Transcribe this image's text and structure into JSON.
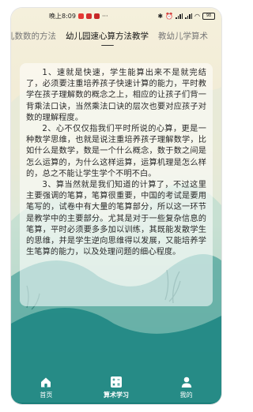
{
  "status_bar": {
    "time": "晚上8:09",
    "battery": "98"
  },
  "tabs": [
    {
      "label": "儿数数的方法",
      "active": false
    },
    {
      "label": "幼儿园速心算方法教学",
      "active": true
    },
    {
      "label": "教幼儿学算术",
      "active": false
    }
  ],
  "article": {
    "paragraphs": [
      "1、速就是快速，学生能算出来不是就完结了，必须要注重培养孩子快速计算的能力，平时教学在孩子理解数的概念之上，相应的让孩子们背一背乘法口诀，当然乘法口诀的层次也要对应孩子对数的理解程度。",
      "2、心不仅仅指我们平时所说的心算，更是一种数学思维，也就是说注重培养孩子理解数学，比如什么是数学，数是一个什么概念，数于数之间是怎么运算的，为什么这样运算，运算机理是怎么样的，总之不能让学生学个不明不白。",
      "3、算当然就是我们知道的计算了，不过这里主要强调的笔算，笔算很重要，中国的考试是要用笔写的，试卷中有大量的笔算部分，所以这一环节是教学中的主要部分。尤其是对于一些复杂信息的笔算，平时必须要多多加以训练，其既能发散学生的思维，并是学生逆向思维得以发展，又能培养学生笔算的能力，以及处理问题的细心程度。"
    ]
  },
  "bottom_nav": [
    {
      "label": "首页",
      "icon": "home-icon",
      "active": false
    },
    {
      "label": "算术学习",
      "icon": "calculator-icon",
      "active": true
    },
    {
      "label": "我的",
      "icon": "user-icon",
      "active": false
    }
  ],
  "colors": {
    "teal": "#1f8a86",
    "cream": "#f5f0dc"
  }
}
